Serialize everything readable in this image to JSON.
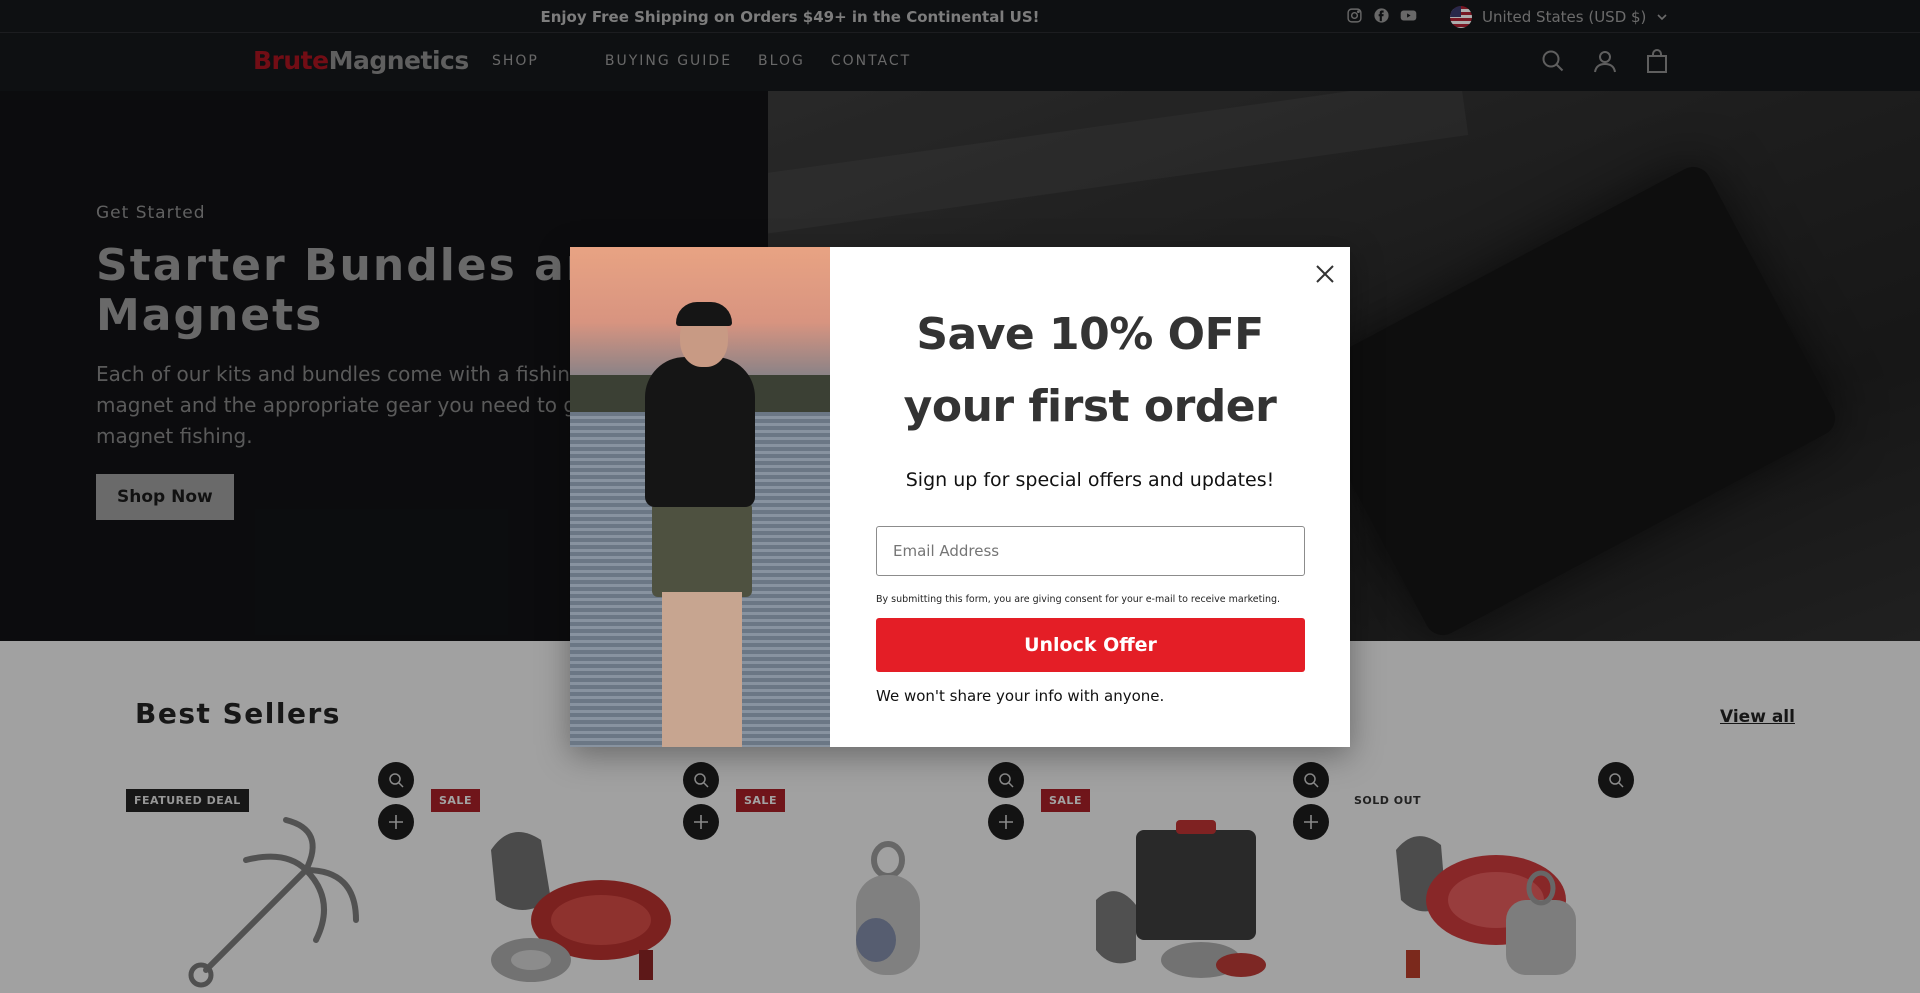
{
  "announcement": {
    "message": "Enjoy Free Shipping on Orders $49+ in the Continental US!",
    "social_icons": [
      "instagram-icon",
      "facebook-icon",
      "youtube-icon"
    ],
    "region": "United States (USD $)"
  },
  "header": {
    "logo_part1": "Brute",
    "logo_part2": "Magnetics",
    "nav": [
      "SHOP",
      "BUYING GUIDE",
      "BLOG",
      "CONTACT"
    ]
  },
  "hero": {
    "kicker": "Get Started",
    "title_line1": "Starter Bundles and",
    "title_line2": "Magnets",
    "subtitle": "Each of our kits and bundles come with a fishing magnet and the appropriate gear you need to go magnet fishing.",
    "button": "Shop Now"
  },
  "best_sellers": {
    "title": "Best Sellers",
    "view_all": "View all",
    "products": [
      {
        "badge": "FEATURED DEAL",
        "badge_style": "dark"
      },
      {
        "badge": "SALE",
        "badge_style": "sale"
      },
      {
        "badge": "SALE",
        "badge_style": "sale"
      },
      {
        "badge": "SALE",
        "badge_style": "sale"
      },
      {
        "badge": "SOLD OUT",
        "badge_style": "sold"
      }
    ]
  },
  "modal": {
    "heading": "Save 10% OFF your first order",
    "subheading": "Sign up for special offers and updates!",
    "email_placeholder": "Email Address",
    "consent": "By submitting this form, you are giving consent for your e-mail to receive marketing.",
    "button": "Unlock Offer",
    "footnote": "We won't share your info with anyone."
  },
  "colors": {
    "brand_red": "#e41e26",
    "dark_bg": "#16181b"
  }
}
